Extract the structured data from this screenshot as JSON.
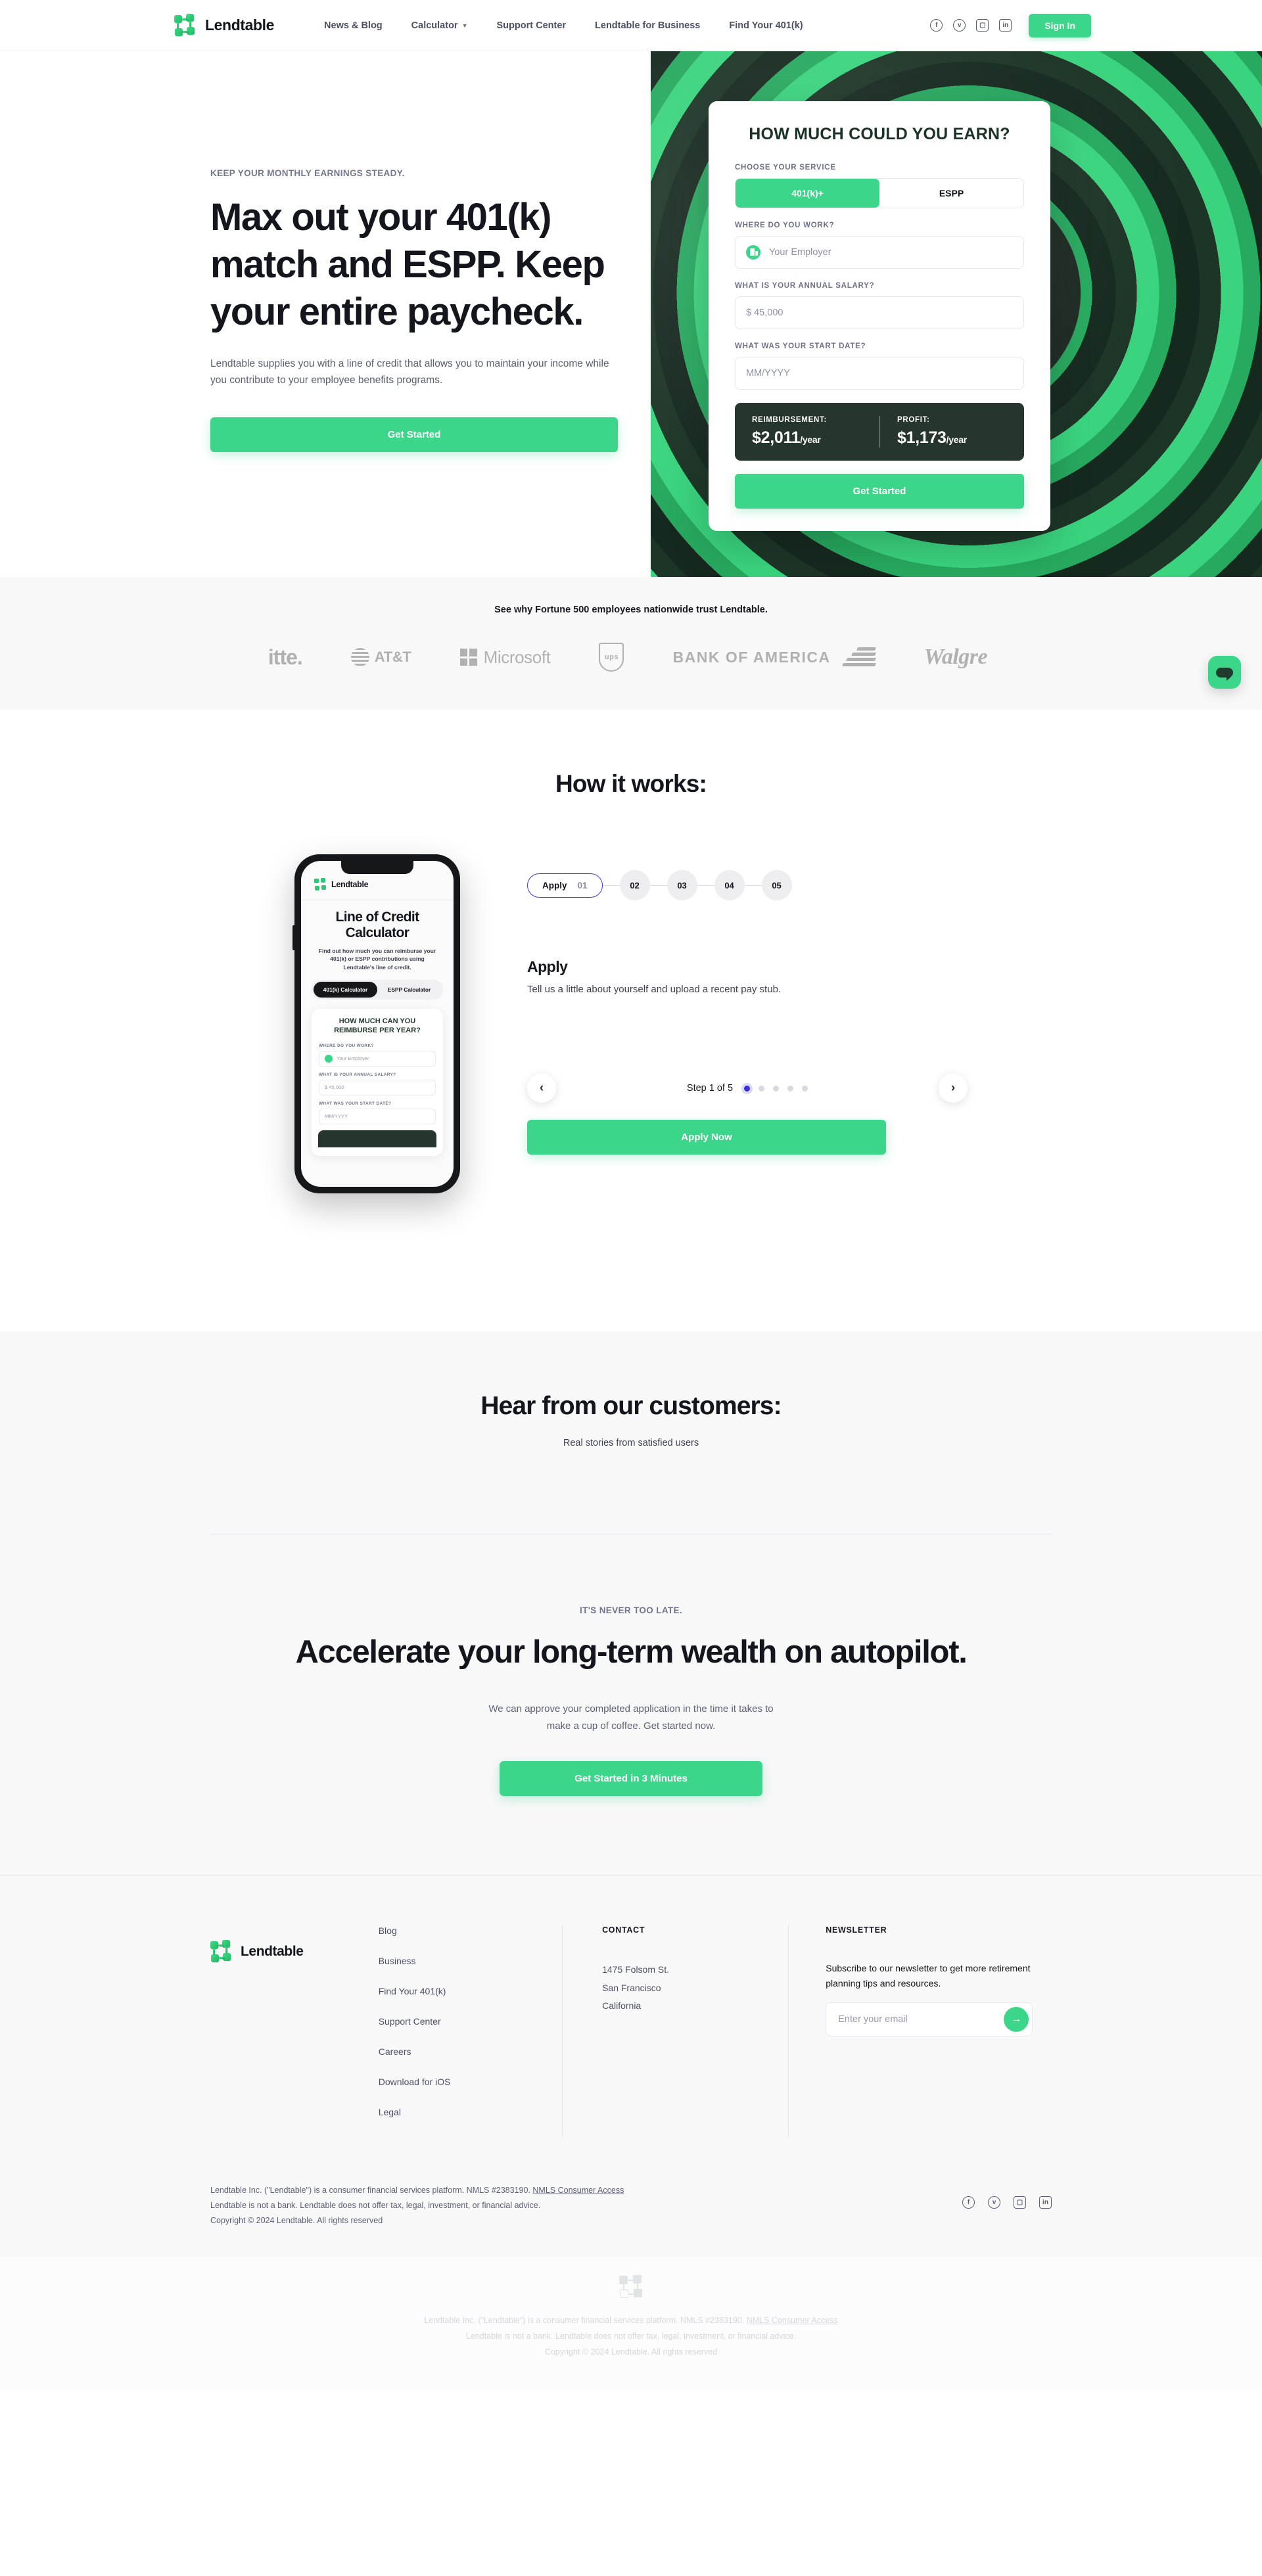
{
  "brand": {
    "name": "Lendtable"
  },
  "nav": {
    "links": [
      {
        "label": "News & Blog",
        "caret": false
      },
      {
        "label": "Calculator",
        "caret": true
      },
      {
        "label": "Support Center",
        "caret": false
      },
      {
        "label": "Lendtable for Business",
        "caret": false
      },
      {
        "label": "Find Your 401(k)",
        "caret": false
      }
    ],
    "socials": [
      "facebook-icon",
      "twitter-icon",
      "instagram-icon",
      "linkedin-icon"
    ],
    "signin_label": "Sign In"
  },
  "hero": {
    "eyebrow": "KEEP YOUR MONTHLY EARNINGS STEADY.",
    "title": "Max out your 401(k) match and ESPP. Keep your entire paycheck.",
    "subtitle": "Lendtable supplies you with a line of credit that allows you to maintain your income while you contribute to your employee benefits programs.",
    "cta_label": "Get Started"
  },
  "calculator": {
    "title": "HOW MUCH COULD YOU EARN?",
    "service_label": "CHOOSE YOUR SERVICE",
    "service_options": [
      "401(k)+",
      "ESPP"
    ],
    "service_selected": "401(k)+",
    "employer_label": "WHERE DO YOU WORK?",
    "employer_placeholder": "Your Employer",
    "salary_label": "WHAT IS YOUR ANNUAL SALARY?",
    "salary_placeholder": "$ 45,000",
    "startdate_label": "WHAT WAS YOUR START DATE?",
    "startdate_placeholder": "MM/YYYY",
    "reimbursement_label": "REIMBURSEMENT:",
    "reimbursement_value": "$2,011",
    "reimbursement_unit": "/year",
    "profit_label": "PROFIT:",
    "profit_value": "$1,173",
    "profit_unit": "/year",
    "cta_label": "Get Started"
  },
  "trustband": {
    "title": "See why Fortune 500 employees nationwide trust Lendtable.",
    "logos": [
      "Deloitte.",
      "AT&T",
      "Microsoft",
      "UPS",
      "BANK OF AMERICA",
      "Walgreens"
    ],
    "deloitte_visible": "itte.",
    "walgreens_visible": "Walgre",
    "ups_label": "ups",
    "boa_label": "BANK OF AMERICA",
    "att_label": "AT&T",
    "ms_label": "Microsoft"
  },
  "how": {
    "title": "How it works:",
    "chips": [
      {
        "label": "Apply",
        "num": "01"
      },
      {
        "label": "",
        "num": "02"
      },
      {
        "label": "",
        "num": "03"
      },
      {
        "label": "",
        "num": "04"
      },
      {
        "label": "",
        "num": "05"
      }
    ],
    "step_title": "Apply",
    "step_desc": "Tell us a little about yourself and upload a recent pay stub.",
    "step_counter": "Step 1 of 5",
    "prev_label": "‹",
    "next_label": "›",
    "apply_label": "Apply Now",
    "phone": {
      "brand": "Lendtable",
      "title": "Line of Credit Calculator",
      "subtitle": "Find out how much you can reimburse your 401(k) or ESPP contributions using Lendtable's line of credit.",
      "tabs": [
        "401(k) Calculator",
        "ESPP Calculator"
      ],
      "tab_selected": "401(k) Calculator",
      "card_title": "HOW MUCH CAN YOU REIMBURSE PER YEAR?",
      "employer_label": "WHERE DO YOU WORK?",
      "employer_placeholder": "Your Employer",
      "salary_label": "WHAT IS YOUR ANNUAL SALARY?",
      "salary_placeholder": "$ 45,000",
      "startdate_label": "WHAT WAS YOUR START DATE?",
      "startdate_placeholder": "MM/YYYY"
    }
  },
  "testimonials": {
    "title": "Hear from our customers:",
    "subtitle": "Real stories from satisfied users"
  },
  "cta": {
    "eyebrow": "IT'S NEVER TOO LATE.",
    "title": "Accelerate your long-term wealth on autopilot.",
    "body": "We can approve your completed application in the time it takes to make a cup of coffee. Get started now.",
    "button_label": "Get Started in 3 Minutes"
  },
  "footer": {
    "brand": "Lendtable",
    "links": [
      "Blog",
      "Business",
      "Find Your 401(k)",
      "Support Center",
      "Careers",
      "Download for iOS",
      "Legal"
    ],
    "contact_heading": "CONTACT",
    "address_line1": "1475 Folsom St.",
    "address_line2": "San Francisco",
    "address_line3": "California",
    "newsletter_heading": "NEWSLETTER",
    "newsletter_text": "Subscribe to our newsletter to get more retirement planning tips and resources.",
    "email_placeholder": "Enter your email",
    "send_icon": "arrow-right-icon",
    "legal_line1_a": "Lendtable Inc. (\"Lendtable\") is a consumer financial services platform. NMLS #2383190. ",
    "legal_link": "NMLS Consumer Access",
    "legal_line2": "Lendtable is not a bank. Lendtable does not offer tax, legal, investment, or financial advice.",
    "legal_line3": "Copyright © 2024 Lendtable. All rights reserved",
    "socials": [
      "facebook-icon",
      "twitter-icon",
      "instagram-icon",
      "linkedin-icon"
    ]
  },
  "ghost_footer": {
    "legal_line1_a": "Lendtable Inc. (\"Lendtable\") is a consumer financial services platform. NMLS #2383190. ",
    "legal_link": "NMLS Consumer Access",
    "legal_line2": "Lendtable is not a bank. Lendtable does not offer tax, legal, investment, or financial advice.",
    "legal_line3": "Copyright © 2024 Lendtable. All rights reserved"
  },
  "chat": {
    "icon": "chat-bubble-icon"
  },
  "colors": {
    "accent_green": "#3cd68a",
    "dark": "#26352e",
    "ink": "#14151d",
    "muted": "#5c5e72",
    "indigo": "#3b2fe0"
  }
}
